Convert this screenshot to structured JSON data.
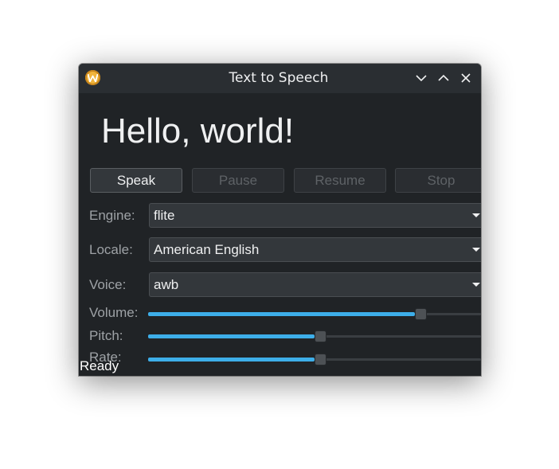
{
  "window": {
    "title": "Text to Speech",
    "app_icon": "kde-w-app-icon",
    "controls": [
      "minimize-chevron-down-icon",
      "maximize-chevron-up-icon",
      "close-x-icon"
    ]
  },
  "main": {
    "text": "Hello, world!"
  },
  "buttons": {
    "speak": "Speak",
    "pause": "Pause",
    "resume": "Resume",
    "stop": "Stop"
  },
  "form": {
    "engine_label": "Engine:",
    "engine_value": "flite",
    "locale_label": "Locale:",
    "locale_value": "American English",
    "voice_label": "Voice:",
    "voice_value": "awb",
    "volume_label": "Volume:",
    "pitch_label": "Pitch:",
    "rate_label": "Rate:"
  },
  "sliders": {
    "volume_fraction": 0.82,
    "pitch_fraction": 0.52,
    "rate_fraction": 0.52
  },
  "status": {
    "text": "Ready"
  },
  "colors": {
    "accent": "#3daee9",
    "window_bg": "#202326",
    "titlebar_bg": "#2a2e32",
    "text": "#eff0f1"
  }
}
